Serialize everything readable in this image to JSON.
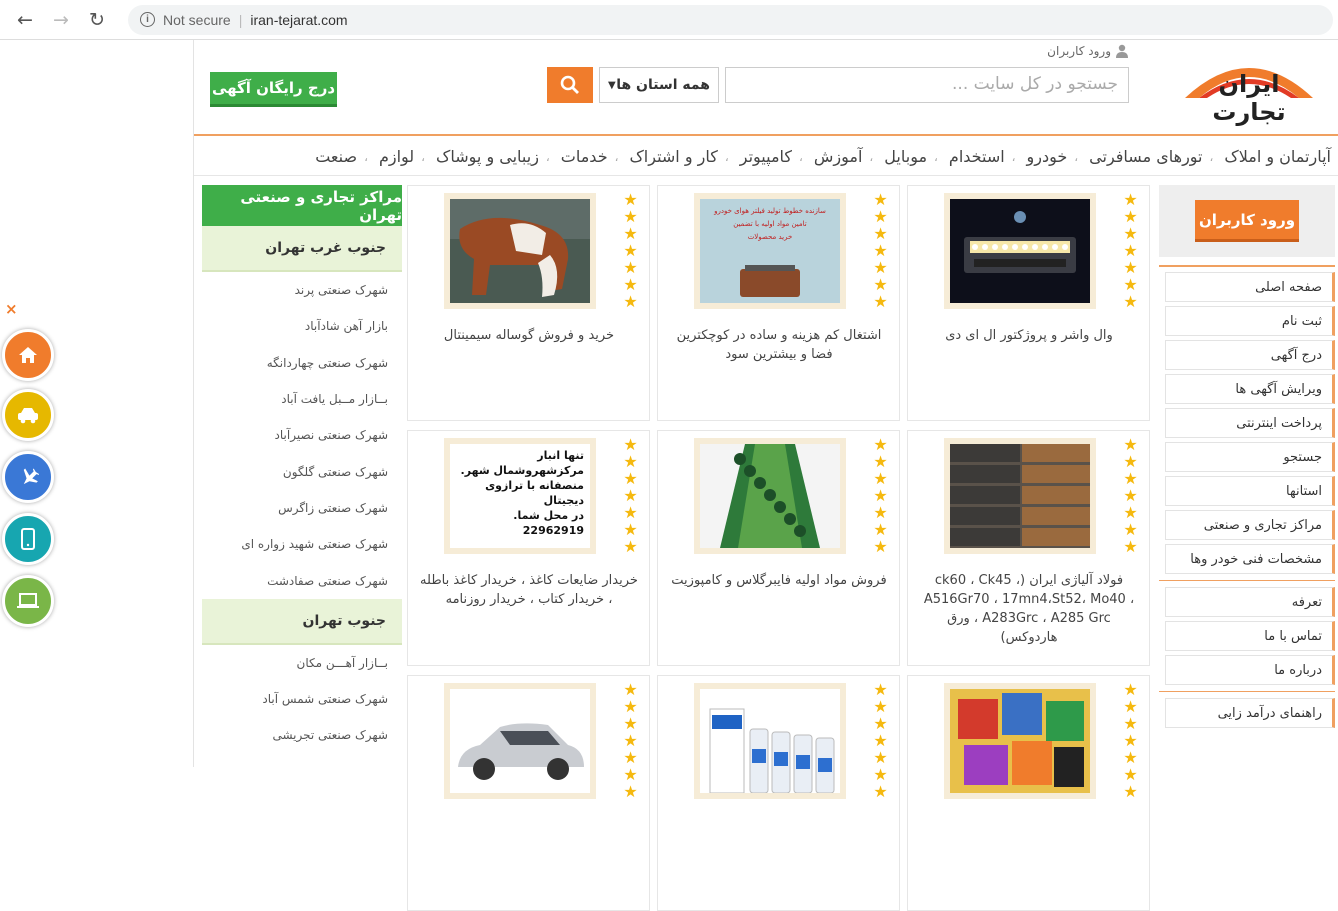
{
  "browser": {
    "back": "←",
    "forward": "→",
    "reload": "↻",
    "info": "i",
    "security": "Not secure",
    "url": "iran-tejarat.com"
  },
  "header": {
    "logo_text": "ایران تجارت",
    "login_link": "ورود کاربران",
    "search_placeholder": "جستجو در کل سایت ...",
    "province_select": "همه استان ها",
    "free_ad_button": "درج رایگان آگهی"
  },
  "categories": [
    "آپارتمان و املاک",
    "تورهای مسافرتی",
    "خودرو",
    "استخدام",
    "موبایل",
    "آموزش",
    "کامپیوتر",
    "کار و اشتراک",
    "خدمات",
    "زیبایی و پوشاک",
    "لوازم",
    "صنعت"
  ],
  "right_sidebar": {
    "login_button": "ورود کاربران",
    "group1": [
      "صفحه اصلی",
      "ثبت نام",
      "درج آگهی",
      "ویرایش آگهی ها",
      "پرداخت اینترنتی",
      "جستجو",
      "استانها",
      "مراکز تجاری و صنعتی",
      "مشخصات فنی خودر وها"
    ],
    "group2": [
      "تعرفه",
      "تماس با ما",
      "درباره ما"
    ],
    "group3": [
      "راهنمای درآمد زایی"
    ]
  },
  "left_sidebar": {
    "header": "مراکز تجاری و صنعتی تهران",
    "section1_title": "جنوب غرب تهران",
    "section1_items": [
      "شهرک صنعتی پرند",
      "بازار آهن شادآباد",
      "شهرک صنعتی چهاردانگه",
      "بــازار مــبل یافت آباد",
      "شهرک صنعتی نصیرآباد",
      "شهرک صنعتی گلگون",
      "شهرک صنعتی زاگرس",
      "شهرک صنعتی شهید زواره ای",
      "شهرک صنعتی صفادشت"
    ],
    "section2_title": "جنوب تهران",
    "section2_items": [
      "بــازار آهـــن مکان",
      "شهرک صنعتی شمس آباد",
      "شهرک صنعتی تجریشی"
    ]
  },
  "products": [
    {
      "title": "وال واشر و پروژکتور ال ای دی",
      "thumb": "led-projector"
    },
    {
      "title": "اشتغال کم هزینه و ساده در کوچکترین فضا و بیشترین سود",
      "thumb": "filter-ad",
      "thumb_text": [
        "سازنده خطوط تولید فیلتر هوای خودرو",
        "تامین مواد اولیه با تضمین",
        "خرید محصولات"
      ]
    },
    {
      "title": "خرید و فروش گوساله سیمینتال",
      "thumb": "calf"
    },
    {
      "title": "فولاد آلیاژی ایران (، ck60 ، Ck45 A516Gr70 ، 17mn4،St52، Mo40 ، A283Grc ، A285 Grc ، ورق هاردوکس)",
      "thumb": "steel"
    },
    {
      "title": "فروش مواد اولیه فایبرگلاس و کامپوزیت",
      "thumb": "fiberglass"
    },
    {
      "title": "خریدار ضایعات کاغذ ، خریدار کاغذ باطله ، خریدار کتاب ، خریدار روزنامه",
      "thumb": "paper-ad",
      "thumb_text": [
        "تنها انبار مرکزشهروشمال شهر.",
        "منصفانه با ترازوی دیجیتال",
        "در محل شما.",
        "22962919"
      ]
    },
    {
      "title": "",
      "thumb": "books"
    },
    {
      "title": "",
      "thumb": "bottles"
    },
    {
      "title": "",
      "thumb": "car"
    }
  ],
  "floating": {
    "close": "×",
    "icons": [
      "home-icon",
      "car-icon",
      "plane-icon",
      "mobile-icon",
      "laptop-icon"
    ]
  },
  "colors": {
    "accent": "#f07c2c",
    "green": "#3fae49",
    "star": "#f5b90f"
  }
}
